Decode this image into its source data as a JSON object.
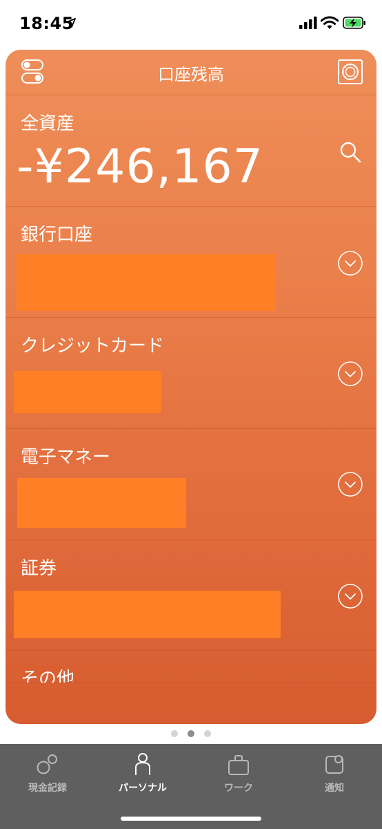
{
  "status_bar": {
    "time": "18:45",
    "icons": [
      "location-arrow-icon",
      "cellular-signal-icon",
      "wifi-icon",
      "battery-charging-icon"
    ],
    "battery_color": "#4CD964"
  },
  "header": {
    "title": "口座残高",
    "left_icon": "toggle-switch-icon",
    "right_icon": "safe-icon"
  },
  "total": {
    "label": "全資産",
    "amount": "-¥246,167",
    "search_icon": "search-icon"
  },
  "sections": [
    {
      "label": "銀行口座",
      "icon": "chevron-down-circle-icon"
    },
    {
      "label": "クレジットカード",
      "icon": "chevron-down-circle-icon"
    },
    {
      "label": "電子マネー",
      "icon": "chevron-down-circle-icon"
    },
    {
      "label": "証券",
      "icon": "chevron-down-circle-icon"
    },
    {
      "label": "その他"
    }
  ],
  "page_indicator": {
    "count": 3,
    "active_index": 1
  },
  "tabbar": {
    "tabs": [
      {
        "label": "現金記録",
        "icon": "circles-icon",
        "active": false
      },
      {
        "label": "パーソナル",
        "icon": "person-icon",
        "active": true
      },
      {
        "label": "ワーク",
        "icon": "briefcase-icon",
        "active": false
      },
      {
        "label": "通知",
        "icon": "notification-icon",
        "active": false
      }
    ]
  },
  "colors": {
    "card_top": "#EF8E59",
    "card_bottom": "#D75C2F",
    "redaction": "#FF7F27",
    "tabbar_background": "#5F5F5F"
  }
}
